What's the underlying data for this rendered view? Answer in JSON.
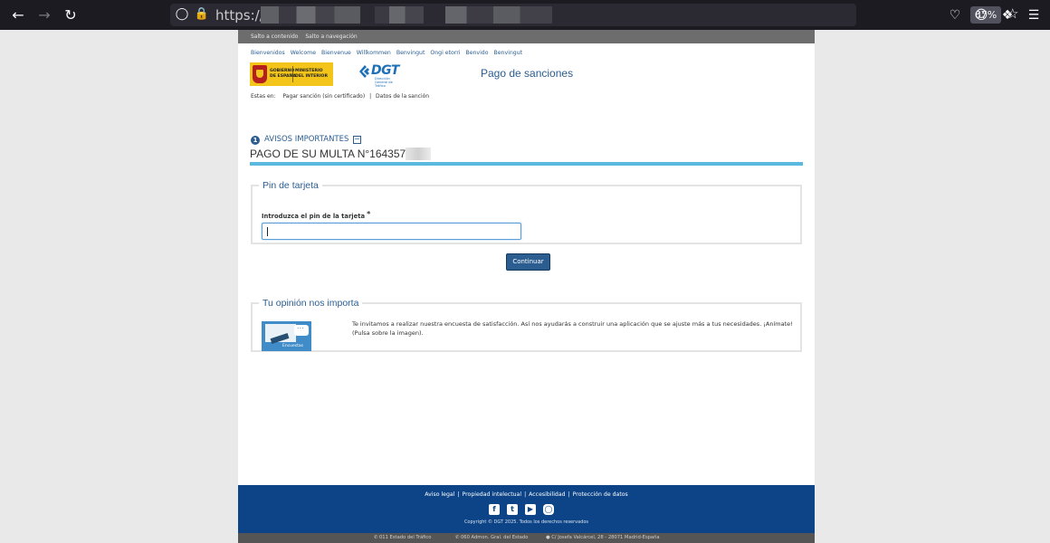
{
  "browser": {
    "url_prefix": "https://",
    "zoom": "67%",
    "icons": [
      "back-icon",
      "forward-icon",
      "reload-icon",
      "shield-icon",
      "lock-icon",
      "bookmark-star-icon",
      "pocket-icon",
      "account-icon",
      "extensions-icon",
      "menu-icon"
    ]
  },
  "skip_links": [
    "Salto a contenido",
    "Salto a navegación"
  ],
  "languages": [
    "Bienvenidos",
    "Welcome",
    "Bienvenue",
    "Willkommen",
    "Benvingut",
    "Ongi etorri",
    "Benvido",
    "Benvingut"
  ],
  "header": {
    "gobierno": [
      "GOBIERNO",
      "DE ESPAÑA"
    ],
    "ministerio": [
      "MINISTERIO",
      "DEL INTERIOR"
    ],
    "dgt_word": "DGT",
    "dgt_sub": "Dirección General de Tráfico",
    "title": "Pago de sanciones"
  },
  "breadcrumb": {
    "lead": "Estas en:",
    "item1": "Pagar sanción (sin certificado)",
    "sep": "|",
    "item2": "Datos de la sanción"
  },
  "avisos": {
    "number": "1",
    "label": "AVISOS IMPORTANTES"
  },
  "multa": {
    "text": "PAGO DE SU MULTA N°164357"
  },
  "pin_section": {
    "legend": "Pin de tarjeta",
    "label": "Introduzca el pin de la tarjeta",
    "required_mark": "*",
    "value": ""
  },
  "continue_button": "Continuar",
  "opinion": {
    "legend": "Tu opinión nos importa",
    "image_label": "Encuestas",
    "text": "Te invitamos a realizar nuestra encuesta de satisfacción. Así nos ayudarás a construir una aplicación que se ajuste más a tus necesidades. ¡Anímate! (Pulsa sobre la imagen)."
  },
  "footer": {
    "links": [
      "Aviso legal",
      "Propiedad intelectual",
      "Accesibilidad",
      "Protección de datos"
    ],
    "separator": "|",
    "social": [
      "facebook-icon",
      "twitter-icon",
      "youtube-icon",
      "instagram-icon"
    ],
    "copyright": "Copyright © DGT 2025. Todos los derechos reservados",
    "contact": [
      "011 Estado del Tráfico",
      "060 Admon. Gral. del Estado",
      "C/ Josefa Valcárcel, 28 - 28071 Madrid-España"
    ]
  },
  "colors": {
    "brand_blue": "#2b5d91",
    "accent_cyan": "#5bb8de",
    "footer_blue": "#0d4487",
    "gobierno_yellow": "#f3c51a"
  }
}
